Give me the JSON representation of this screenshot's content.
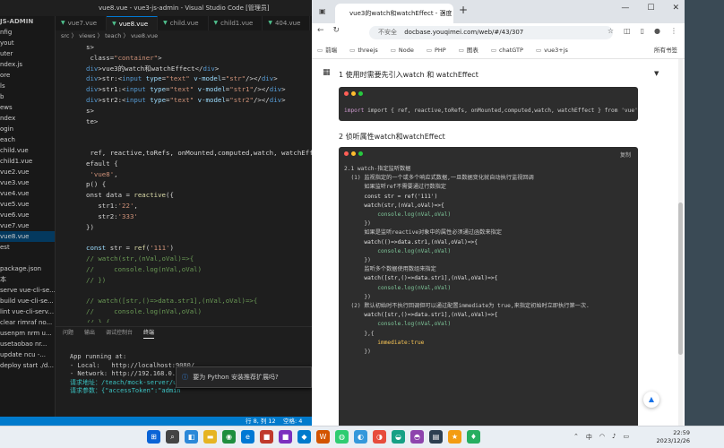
{
  "vscode": {
    "title": "vue8.vue - vue3-js-admin - Visual Studio Code [管理员]",
    "tabs": [
      "vue7.vue",
      "vue8.vue",
      "child.vue",
      "child1.vue",
      "404.vue"
    ],
    "active_tab": 1,
    "breadcrumb": "src 〉 views 〉 teach 〉 vue8.vue",
    "sidebar": [
      "JS-ADMIN",
      "nfig",
      "yout",
      "uter",
      "ndex.js",
      "ore",
      "ls",
      "b",
      "ews",
      "ndex",
      "ogin",
      "each",
      "child.vue",
      "child1.vue",
      "vue2.vue",
      "vue3.vue",
      "vue4.vue",
      "vue5.vue",
      "vue6.vue",
      "vue7.vue",
      "vue8.vue",
      "est",
      "",
      "package.json",
      "本",
      "serve vue-cli-se...",
      "build vue-cli-se...",
      "lint vue-cli-serv...",
      "clear rimraf no...",
      "usenpm nrm u...",
      "usetaobao nr...",
      "update ncu -...",
      "deploy start ./d..."
    ],
    "sidebar_selected": 20,
    "code_lines": [
      [
        "s>",
        ""
      ],
      [
        " class=\"container\">",
        ""
      ],
      [
        "div>vue3的watch和watchEffect</div>",
        ""
      ],
      [
        "div>str:<input type=\"text\" v-model=\"str\"/></div>",
        ""
      ],
      [
        "div>str1:<input type=\"text\" v-model=\"str1\"/></div>",
        ""
      ],
      [
        "div>str2:<input type=\"text\" v-model=\"str2\"/></div>",
        ""
      ],
      [
        "s>",
        ""
      ],
      [
        "te>",
        ""
      ],
      [
        "",
        ""
      ],
      [
        "",
        ""
      ],
      [
        " ref, reactive,toRefs, onMounted,computed,watch, watchEffect",
        ""
      ],
      [
        "efault {",
        ""
      ],
      [
        " 'vue8',",
        ""
      ],
      [
        "p() {",
        ""
      ],
      [
        "onst data = reactive({",
        ""
      ],
      [
        "   str1:'22',",
        ""
      ],
      [
        "   str2:'333'",
        ""
      ],
      [
        "})",
        ""
      ],
      [
        "",
        ""
      ],
      [
        "const str = ref('111')",
        ""
      ],
      [
        "// watch(str,(nVal,oVal)=>{",
        ""
      ],
      [
        "//     console.log(nVal,oVal)",
        ""
      ],
      [
        "// })",
        ""
      ],
      [
        "",
        ""
      ],
      [
        "// watch([str,()=>data.str1],(nVal,oVal)=>{",
        ""
      ],
      [
        "//     console.log(nVal,oVal)",
        ""
      ],
      [
        "// },{",
        ""
      ],
      [
        "//     immediate:true",
        ""
      ]
    ],
    "panel": {
      "tabs": [
        "问题",
        "输出",
        "调试控制台",
        "终端"
      ],
      "active": 3,
      "lines": [
        "App running at:",
        "- Local:   http://localhost:9080/",
        "- Network: http://192.168.0.107",
        "",
        "请求地址：/teach/mock-server/u",
        "请求参数：{\"accessToken\":\"admin"
      ]
    },
    "toast": "要为 Python 安装推荐扩展吗?",
    "status": [
      "行 8, 列 12",
      "空格: 4",
      "UTF-8",
      "CRLF",
      "Vue"
    ]
  },
  "browser": {
    "tab_title": "vue3的watch和watchEffect - 百度",
    "url_label": "不安全",
    "url": "docbase.youqimei.com/web/#/43/307",
    "bookmarks": [
      "前端",
      "threejs",
      "Node",
      "PHP",
      "图表",
      "chatGTP",
      "vue3+js"
    ],
    "bookmarks_right": "所有书签",
    "section1": "1 使用时需要先引入watch 和 watchEffect",
    "import_line": "import { ref, reactive,toRefs, onMounted,computed,watch, watchEffect } from 'vue'",
    "section2": "2 侦听属性watch和watchEffect",
    "copy_label": "复制",
    "code2": [
      "2.1 watch-指定监听数据",
      "  (1) 监视指定的一个或多个响应式数据,一旦数据变化就自动执行监视回调",
      "      如果监听ref不需要通过行数指定",
      "",
      "      const str = ref('111')",
      "      watch(str,(nVal,oVal)=>{",
      "          console.log(nVal,oVal)",
      "      })",
      "",
      "      如果是监听reactive对象中的属性必须通过函数来指定",
      "",
      "      watch(()=>data.str1,(nVal,oVal)=>{",
      "          console.log(nVal,oVal)",
      "      })",
      "",
      "      监听多个数据使用数组来指定",
      "",
      "      watch([str,()=>data.str1],(nVal,oVal)=>{",
      "          console.log(nVal,oVal)",
      "      })",
      "",
      "  (2) 默认初始时不执行回调但可以通过配置immediate为 true,来指定初始时立即执行第一次.",
      "",
      "      watch([str,()=>data.str1],(nVal,oVal)=>{",
      "          console.log(nVal,oVal)",
      "      },{",
      "          immediate:true",
      "      })"
    ]
  },
  "taskbar": {
    "time": "22:59",
    "date": "2023/12/26",
    "tray_label": "中"
  }
}
